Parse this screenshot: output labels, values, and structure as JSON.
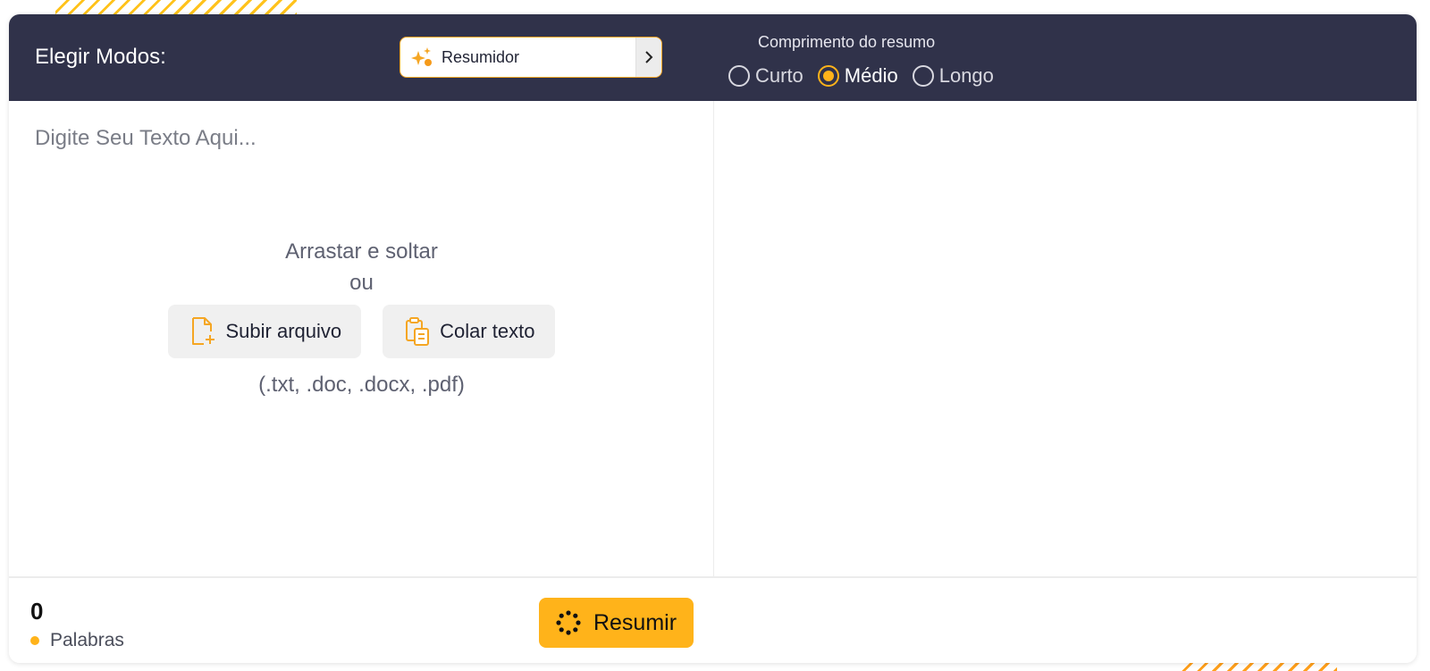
{
  "header": {
    "modes_label": "Elegir Modos:",
    "mode_select": {
      "value": "Resumidor",
      "icon": "sparkles-icon"
    },
    "length": {
      "title": "Comprimento do resumo",
      "options": [
        {
          "label": "Curto",
          "checked": false
        },
        {
          "label": "Médio",
          "checked": true
        },
        {
          "label": "Longo",
          "checked": false
        }
      ]
    }
  },
  "input": {
    "placeholder": "Digite Seu Texto Aqui...",
    "value": ""
  },
  "drop_zone": {
    "title": "Arrastar e soltar",
    "or": "ou",
    "upload_label": "Subir arquivo",
    "paste_label": "Colar texto",
    "formats": "(.txt, .doc, .docx, .pdf)"
  },
  "footer": {
    "word_count": "0",
    "word_label": "Palabras",
    "submit_label": "Resumir"
  },
  "colors": {
    "header_bg": "#30324a",
    "accent": "#ffb31a",
    "accent_orange": "#f5a623"
  }
}
